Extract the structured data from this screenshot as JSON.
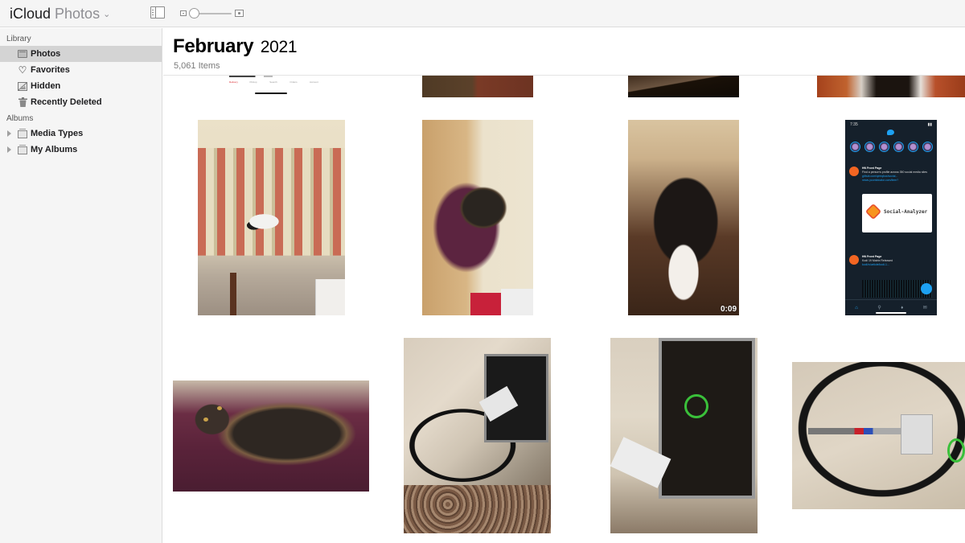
{
  "app": {
    "brand": "iCloud",
    "product": "Photos",
    "menu_icon": "chevron-down-icon"
  },
  "toolbar": {
    "sidebar_toggle_icon": "sidebar-icon",
    "zoom_out_icon": "small-photo-icon",
    "zoom_in_icon": "large-photo-icon",
    "zoom_level": 0.0
  },
  "sidebar": {
    "library_label": "Library",
    "library_items": [
      {
        "label": "Photos",
        "icon": "photos-icon",
        "selected": true
      },
      {
        "label": "Favorites",
        "icon": "heart-icon",
        "selected": false
      },
      {
        "label": "Hidden",
        "icon": "hidden-icon",
        "selected": false
      },
      {
        "label": "Recently Deleted",
        "icon": "trash-icon",
        "selected": false
      }
    ],
    "albums_label": "Albums",
    "album_items": [
      {
        "label": "Media Types",
        "icon": "album-stack-icon",
        "expandable": true
      },
      {
        "label": "My Albums",
        "icon": "album-stack-icon",
        "expandable": true
      }
    ]
  },
  "main": {
    "month": "February",
    "year": "2021",
    "item_count": "5,061 Items",
    "photos": [
      {
        "description": "Screenshot of food delivery app tab bar",
        "tabs": [
          "Delivery",
          "Pickup",
          "Search",
          "Orders",
          "Account"
        ],
        "partial": true
      },
      {
        "description": "Wooden floor and blanket",
        "partial": true
      },
      {
        "description": "Dark fur on wood",
        "partial": true
      },
      {
        "description": "Wooden floor close-up",
        "partial": true
      },
      {
        "description": "Black and white cat on striped armchair"
      },
      {
        "description": "Tortoiseshell cat curled on purple blanket"
      },
      {
        "description": "Black and white cat close-up video",
        "is_video": true,
        "duration": "0:09"
      },
      {
        "description": "Twitter app screenshot",
        "status_time": "7:35",
        "post1": {
          "author": "HN Front Page",
          "text": "Find a person's profile across 350 social media sites",
          "card": "Social-Analyzer",
          "card_link": "qeeqbox/social-analyzer",
          "card_domain": "github.com"
        },
        "post2": {
          "author": "HN Front Page",
          "text": "Kodi 19 Matrix Released"
        }
      },
      {
        "description": "Tortoiseshell cat on purple blanket"
      },
      {
        "description": "Coax cable splitter in wall box with hand"
      },
      {
        "description": "Coax splitter with green ties in wall box"
      },
      {
        "description": "Coax splitter connected outdoor"
      }
    ]
  }
}
